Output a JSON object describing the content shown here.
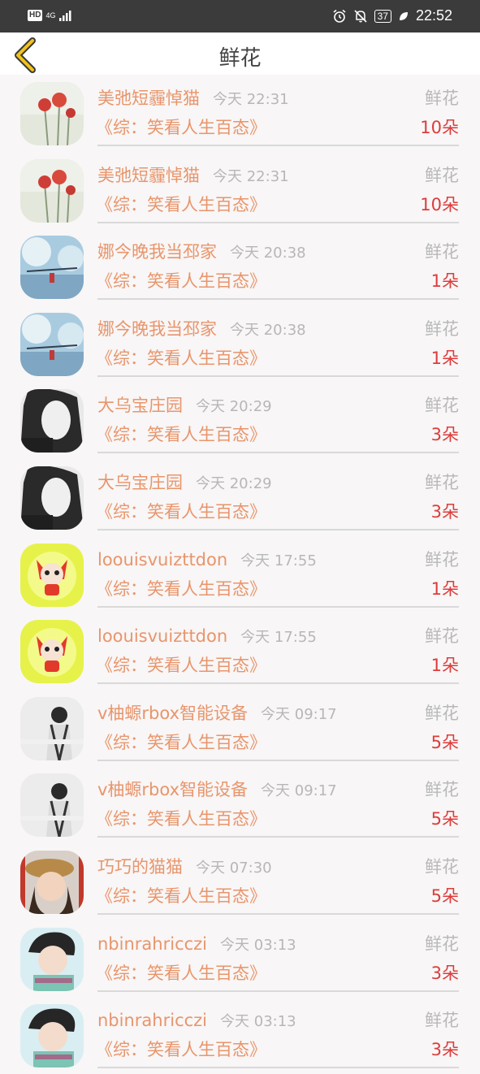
{
  "status_bar": {
    "left_badge": "HD",
    "network": "4G",
    "battery": "37",
    "time": "22:52"
  },
  "header": {
    "title": "鲜花",
    "back_icon": "chevron-left-icon"
  },
  "colors": {
    "accent": "#e8956c",
    "count": "#dd3c3c",
    "muted": "#b7b7b7"
  },
  "rows": [
    {
      "name": "美弛短霾悼猫",
      "time": "今天 22:31",
      "gift": "鲜花",
      "book": "《综：笑看人生百态》",
      "count": "10朵",
      "avatar": "avatar-red-flower"
    },
    {
      "name": "美弛短霾悼猫",
      "time": "今天 22:31",
      "gift": "鲜花",
      "book": "《综：笑看人生百态》",
      "count": "10朵",
      "avatar": "avatar-red-flower"
    },
    {
      "name": "娜今晚我当邳家",
      "time": "今天 20:38",
      "gift": "鲜花",
      "book": "《综：笑看人生百态》",
      "count": "1朵",
      "avatar": "avatar-blue-scene"
    },
    {
      "name": "娜今晚我当邳家",
      "time": "今天 20:38",
      "gift": "鲜花",
      "book": "《综：笑看人生百态》",
      "count": "1朵",
      "avatar": "avatar-blue-scene"
    },
    {
      "name": "大乌宝庄园",
      "time": "今天 20:29",
      "gift": "鲜花",
      "book": "《综：笑看人生百态》",
      "count": "3朵",
      "avatar": "avatar-bw-girl"
    },
    {
      "name": "大乌宝庄园",
      "time": "今天 20:29",
      "gift": "鲜花",
      "book": "《综：笑看人生百态》",
      "count": "3朵",
      "avatar": "avatar-bw-girl"
    },
    {
      "name": "loouisvuizttdon",
      "time": "今天 17:55",
      "gift": "鲜花",
      "book": "《综：笑看人生百态》",
      "count": "1朵",
      "avatar": "avatar-cartoon-fox"
    },
    {
      "name": "loouisvuizttdon",
      "time": "今天 17:55",
      "gift": "鲜花",
      "book": "《综：笑看人生百态》",
      "count": "1朵",
      "avatar": "avatar-cartoon-fox"
    },
    {
      "name": "v柚螈rbox智能设备",
      "time": "今天 09:17",
      "gift": "鲜花",
      "book": "《综：笑看人生百态》",
      "count": "5朵",
      "avatar": "avatar-grey-portrait"
    },
    {
      "name": "v柚螈rbox智能设备",
      "time": "今天 09:17",
      "gift": "鲜花",
      "book": "《综：笑看人生百态》",
      "count": "5朵",
      "avatar": "avatar-grey-portrait"
    },
    {
      "name": "巧巧的猫猫",
      "time": "今天 07:30",
      "gift": "鲜花",
      "book": "《综：笑看人生百态》",
      "count": "5朵",
      "avatar": "avatar-hat-girl"
    },
    {
      "name": "nbinrahricczi",
      "time": "今天 03:13",
      "gift": "鲜花",
      "book": "《综：笑看人生百态》",
      "count": "3朵",
      "avatar": "avatar-boy"
    },
    {
      "name": "nbinrahricczi",
      "time": "今天 03:13",
      "gift": "鲜花",
      "book": "《综：笑看人生百态》",
      "count": "3朵",
      "avatar": "avatar-boy"
    }
  ]
}
